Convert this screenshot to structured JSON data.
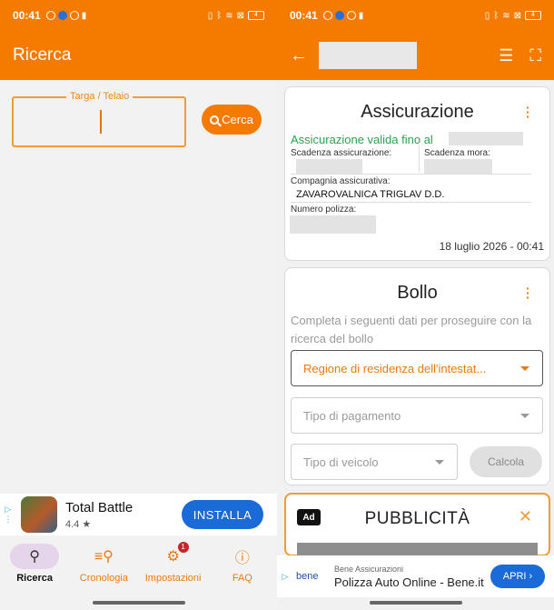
{
  "status": {
    "time": "00:41",
    "battery": "4"
  },
  "left": {
    "app_title": "Ricerca",
    "field_label": "Targa / Telaio",
    "search_button": "Cerca",
    "ad": {
      "name": "Total Battle",
      "rating": "4.4 ★",
      "install": "INSTALLA"
    },
    "nav": [
      {
        "label": "Ricerca",
        "icon": "search-icon"
      },
      {
        "label": "Cronologia",
        "icon": "history-search-icon"
      },
      {
        "label": "Impostazioni",
        "icon": "settings-gear-icon",
        "badge": "1"
      },
      {
        "label": "FAQ",
        "icon": "help-circle-icon"
      }
    ]
  },
  "right": {
    "insurance": {
      "title": "Assicurazione",
      "valid_text": "Assicurazione valida fino al",
      "expiry_label": "Scadenza assicurazione:",
      "grace_label": "Scadenza mora:",
      "company_label": "Compagnia assicurativa:",
      "company_value": "ZAVAROVALNICA TRIGLAV D.D.",
      "policy_label": "Numero polizza:",
      "timestamp": "18 luglio 2026 - 00:41"
    },
    "bollo": {
      "title": "Bollo",
      "description": "Completa i seguenti dati per proseguire con la ricerca del bollo",
      "region_select": "Regione di residenza dell'intestat...",
      "payment_select": "Tipo di pagamento",
      "vehicle_select": "Tipo di veicolo",
      "calc_button": "Calcola"
    },
    "ad_card": {
      "badge": "Ad",
      "title": "PUBBLICITÀ",
      "close": "✕"
    },
    "banner": {
      "logo": "bene",
      "advertiser": "Bene Assicurazioni",
      "headline": "Polizza Auto Online - Bene.it",
      "cta": "APRI ›"
    }
  },
  "colors": {
    "accent": "#f47b00",
    "valid_green": "#2fa04d",
    "cta_blue": "#1a6ad8"
  }
}
